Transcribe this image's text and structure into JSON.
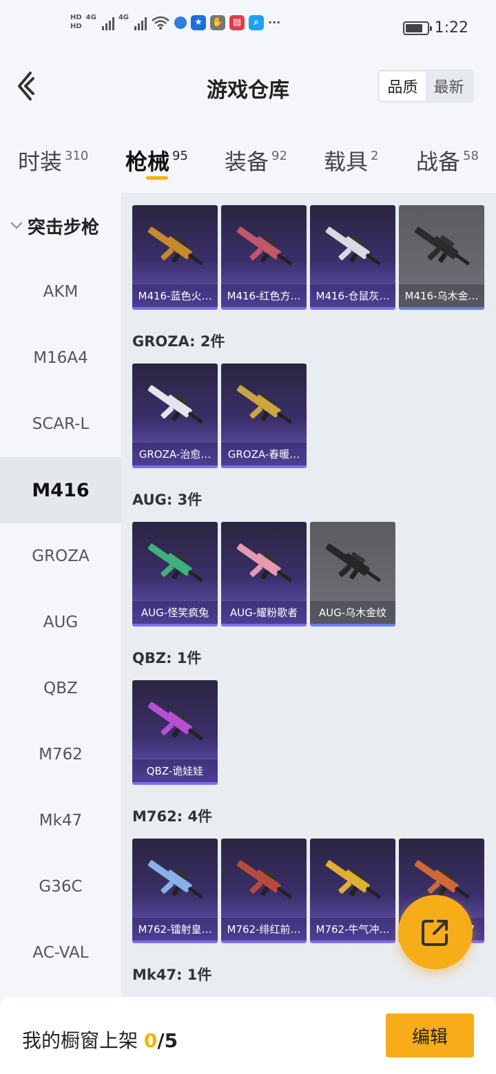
{
  "status_bar": {
    "time": "1:22",
    "network_a": "4G",
    "network_b": "4G",
    "hd1": "HD",
    "hd2": "HD",
    "more": "···"
  },
  "header": {
    "title": "游戏仓库",
    "sort_options": [
      "品质",
      "最新"
    ],
    "sort_selected": "品质"
  },
  "tabs": [
    {
      "label": "时装",
      "count": "310"
    },
    {
      "label": "枪械",
      "count": "95",
      "active": true
    },
    {
      "label": "装备",
      "count": "92"
    },
    {
      "label": "载具",
      "count": "2"
    },
    {
      "label": "战备",
      "count": "58"
    }
  ],
  "sidebar": {
    "group_label": "突击步枪",
    "items": [
      "AKM",
      "M16A4",
      "SCAR-L",
      "M416",
      "GROZA",
      "AUG",
      "QBZ",
      "M762",
      "Mk47",
      "G36C",
      "AC-VAL"
    ],
    "active": "M416"
  },
  "sections": [
    {
      "title": "",
      "items": [
        {
          "label": "M416-蓝色火…",
          "style": "purple",
          "gun_color": "#c8892a"
        },
        {
          "label": "M416-红色方…",
          "style": "purple",
          "gun_color": "#c4566b"
        },
        {
          "label": "M416-仓鼠灰…",
          "style": "purple",
          "gun_color": "#d9d9e0"
        },
        {
          "label": "M416-乌木金…",
          "style": "gray",
          "gun_color": "#2b2b2b"
        }
      ]
    },
    {
      "title": "GROZA: 2件",
      "items": [
        {
          "label": "GROZA-治愈…",
          "style": "purple",
          "gun_color": "#e6e2ee"
        },
        {
          "label": "GROZA-春暖…",
          "style": "purple",
          "gun_color": "#c9a63e"
        }
      ]
    },
    {
      "title": "AUG: 3件",
      "items": [
        {
          "label": "AUG-怪笑疯兔",
          "style": "purple",
          "gun_color": "#3fb07e"
        },
        {
          "label": "AUG-耀粉歌者",
          "style": "purple",
          "gun_color": "#e59ab0"
        },
        {
          "label": "AUG-乌木金纹",
          "style": "gray",
          "gun_color": "#262626"
        }
      ]
    },
    {
      "title": "QBZ: 1件",
      "items": [
        {
          "label": "QBZ-诡娃娃",
          "style": "purple",
          "gun_color": "#b84fd0"
        }
      ]
    },
    {
      "title": "M762: 4件",
      "items": [
        {
          "label": "M762-镭射皇…",
          "style": "purple",
          "gun_color": "#8ab0e8"
        },
        {
          "label": "M762-绯红前…",
          "style": "purple",
          "gun_color": "#b84a3c"
        },
        {
          "label": "M762-牛气冲…",
          "style": "purple",
          "gun_color": "#e0b030"
        },
        {
          "label": "M762-拳皇97",
          "style": "purple",
          "gun_color": "#d0683a"
        }
      ]
    },
    {
      "title": "Mk47: 1件",
      "items": [
        {
          "label": "",
          "style": "purple",
          "gun_color": "#d4a020"
        }
      ]
    }
  ],
  "bottom_bar": {
    "shelf_label": "我的橱窗上架",
    "shelf_count": "0",
    "shelf_sep": "/",
    "shelf_total": "5",
    "edit_label": "编辑"
  },
  "colors": {
    "accent": "#f7ad19",
    "tab_underline": "#f4b400",
    "card_purple": "#3b2f6b",
    "card_gray": "#5a5c62"
  },
  "icons": [
    "back-arrow-icon",
    "share-icon",
    "gun-icon",
    "chevron-down-icon"
  ]
}
